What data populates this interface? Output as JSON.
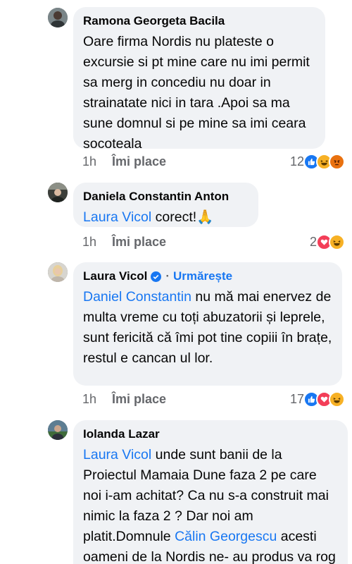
{
  "comments": [
    {
      "author": "Ramona Georgeta Bacila",
      "text": "Oare firma Nordis nu plateste o excursie si pt mine care nu imi permit sa merg in concediu nu doar in strainatate nici in tara .Apoi sa ma sune domnul si pe mine sa imi ceara socoteala",
      "time": "1h",
      "like_label": "Îmi place",
      "reaction_count": "12",
      "reactions": [
        "like-icon",
        "haha-icon",
        "angry-icon"
      ]
    },
    {
      "author": "Daniela Constantin Anton",
      "mention": "Laura Vicol",
      "text": " corect!🙏",
      "time": "1h",
      "like_label": "Îmi place",
      "reaction_count": "2",
      "reactions": [
        "love-icon",
        "haha-icon"
      ]
    },
    {
      "author": "Laura Vicol",
      "verified": true,
      "follow_label": "Urmărește",
      "mention": "Daniel Constantin",
      "text": " nu mă mai enervez de multa vreme cu toți abuzatorii și leprele, sunt fericită că îmi pot tine copiii în brațe, restul e cancan ul lor.",
      "time": "1h",
      "like_label": "Îmi place",
      "reaction_count": "17",
      "reactions": [
        "like-icon",
        "love-icon",
        "haha-icon"
      ]
    },
    {
      "author": "Iolanda Lazar",
      "mention": "Laura Vicol",
      "text_a": " unde sunt banii de la Proiectul Mamaia Dune faza 2 pe care noi i-am achitat? Ca nu s-a construit mai nimic la faza 2 ? Dar noi am platit.Domnule ",
      "mention2": "Călin Georgescu",
      "text_b": "  acesti oameni de la Nordis ne- au produs  va rog sa nu ii"
    }
  ],
  "colors": {
    "bubble": "#f0f2f5",
    "mention": "#1877f2",
    "meta": "#65676b"
  }
}
